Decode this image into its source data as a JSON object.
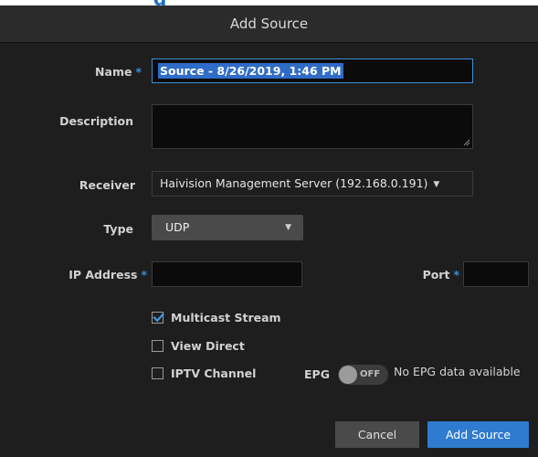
{
  "page": {
    "background_heading": "g"
  },
  "dialog": {
    "title": "Add Source",
    "required_marker": "*",
    "fields": {
      "name": {
        "label": "Name",
        "value": "Source - 8/26/2019, 1:46 PM",
        "required": true
      },
      "description": {
        "label": "Description",
        "value": ""
      },
      "receiver": {
        "label": "Receiver",
        "value": "Haivision Management Server (192.168.0.191)"
      },
      "type": {
        "label": "Type",
        "value": "UDP"
      },
      "ip_address": {
        "label": "IP Address",
        "value": "",
        "required": true
      },
      "port": {
        "label": "Port",
        "value": "",
        "required": true
      }
    },
    "options": {
      "multicast_stream": {
        "label": "Multicast Stream",
        "checked": true
      },
      "view_direct": {
        "label": "View Direct",
        "checked": false
      },
      "iptv_channel": {
        "label": "IPTV Channel",
        "checked": false
      }
    },
    "epg": {
      "label": "EPG",
      "toggle_text": "OFF",
      "status": "No EPG data available"
    },
    "buttons": {
      "cancel": "Cancel",
      "submit": "Add Source"
    }
  },
  "colors": {
    "accent": "#2e7bd0",
    "required": "#3a8fd9",
    "dialog_bg": "#1e1e1e",
    "header_bg": "#2b2b2b",
    "heading_blue": "#1a6fc0"
  },
  "icons": {
    "select_caret": "caret-down-icon",
    "checkbox_tick": "check-icon",
    "resize_grip": "resize-grip-icon"
  }
}
